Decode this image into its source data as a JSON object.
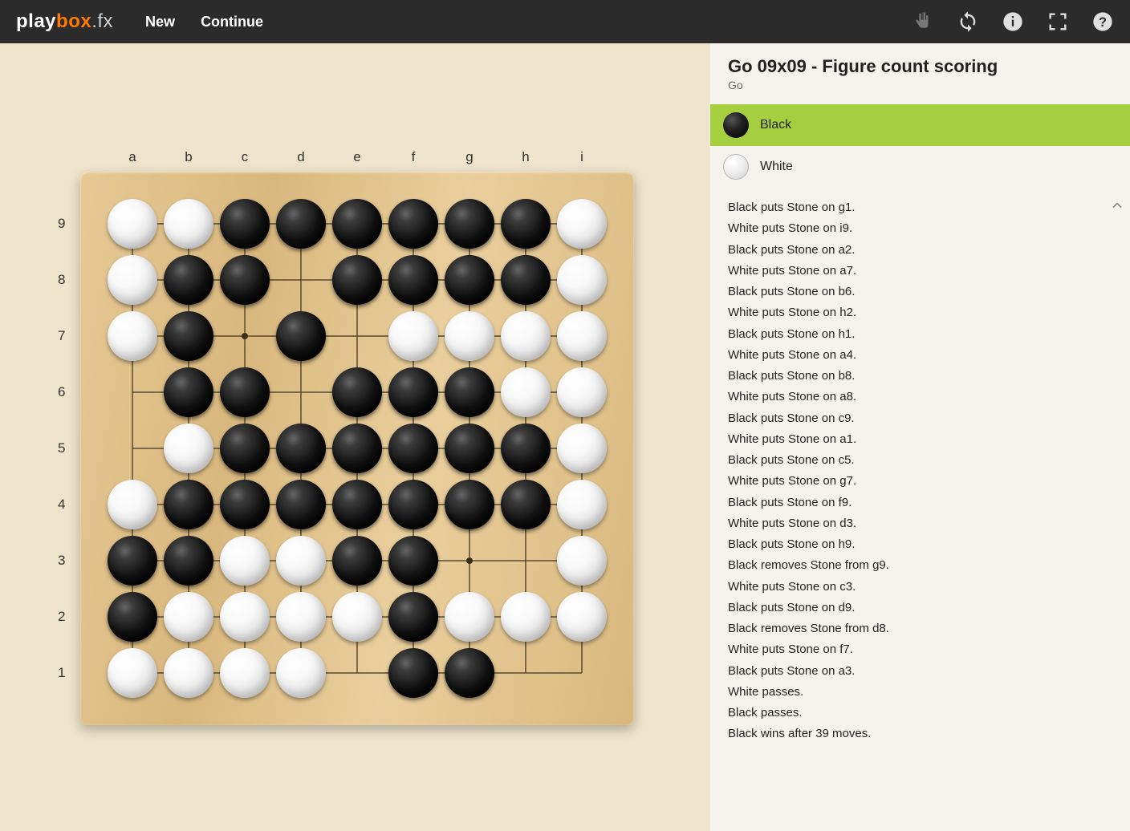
{
  "logo": {
    "part1": "play",
    "part2": "box",
    "part3": ".fx"
  },
  "nav": {
    "new": "New",
    "continue": "Continue"
  },
  "title": "Go 09x09 - Figure count scoring",
  "subtitle": "Go",
  "players": [
    {
      "name": "Black",
      "color": "B",
      "active": true
    },
    {
      "name": "White",
      "color": "W",
      "active": false
    }
  ],
  "board": {
    "size": 9,
    "cols": [
      "a",
      "b",
      "c",
      "d",
      "e",
      "f",
      "g",
      "h",
      "i"
    ],
    "rows": [
      "1",
      "2",
      "3",
      "4",
      "5",
      "6",
      "7",
      "8",
      "9"
    ],
    "stones": [
      {
        "c": "a",
        "r": 9,
        "s": "W"
      },
      {
        "c": "b",
        "r": 9,
        "s": "W"
      },
      {
        "c": "c",
        "r": 9,
        "s": "B"
      },
      {
        "c": "d",
        "r": 9,
        "s": "B"
      },
      {
        "c": "e",
        "r": 9,
        "s": "B"
      },
      {
        "c": "f",
        "r": 9,
        "s": "B"
      },
      {
        "c": "g",
        "r": 9,
        "s": "B"
      },
      {
        "c": "h",
        "r": 9,
        "s": "B"
      },
      {
        "c": "i",
        "r": 9,
        "s": "W"
      },
      {
        "c": "a",
        "r": 8,
        "s": "W"
      },
      {
        "c": "b",
        "r": 8,
        "s": "B"
      },
      {
        "c": "c",
        "r": 8,
        "s": "B"
      },
      {
        "c": "e",
        "r": 8,
        "s": "B"
      },
      {
        "c": "f",
        "r": 8,
        "s": "B"
      },
      {
        "c": "g",
        "r": 8,
        "s": "B"
      },
      {
        "c": "h",
        "r": 8,
        "s": "B"
      },
      {
        "c": "i",
        "r": 8,
        "s": "W"
      },
      {
        "c": "a",
        "r": 7,
        "s": "W"
      },
      {
        "c": "b",
        "r": 7,
        "s": "B"
      },
      {
        "c": "d",
        "r": 7,
        "s": "B"
      },
      {
        "c": "f",
        "r": 7,
        "s": "W"
      },
      {
        "c": "g",
        "r": 7,
        "s": "W"
      },
      {
        "c": "h",
        "r": 7,
        "s": "W"
      },
      {
        "c": "i",
        "r": 7,
        "s": "W"
      },
      {
        "c": "b",
        "r": 6,
        "s": "B"
      },
      {
        "c": "c",
        "r": 6,
        "s": "B"
      },
      {
        "c": "e",
        "r": 6,
        "s": "B"
      },
      {
        "c": "f",
        "r": 6,
        "s": "B"
      },
      {
        "c": "g",
        "r": 6,
        "s": "B"
      },
      {
        "c": "h",
        "r": 6,
        "s": "W"
      },
      {
        "c": "i",
        "r": 6,
        "s": "W"
      },
      {
        "c": "b",
        "r": 5,
        "s": "W"
      },
      {
        "c": "c",
        "r": 5,
        "s": "B"
      },
      {
        "c": "d",
        "r": 5,
        "s": "B"
      },
      {
        "c": "e",
        "r": 5,
        "s": "B"
      },
      {
        "c": "f",
        "r": 5,
        "s": "B"
      },
      {
        "c": "g",
        "r": 5,
        "s": "B"
      },
      {
        "c": "h",
        "r": 5,
        "s": "B"
      },
      {
        "c": "i",
        "r": 5,
        "s": "W"
      },
      {
        "c": "a",
        "r": 4,
        "s": "W"
      },
      {
        "c": "b",
        "r": 4,
        "s": "B"
      },
      {
        "c": "c",
        "r": 4,
        "s": "B"
      },
      {
        "c": "d",
        "r": 4,
        "s": "B"
      },
      {
        "c": "e",
        "r": 4,
        "s": "B"
      },
      {
        "c": "f",
        "r": 4,
        "s": "B"
      },
      {
        "c": "g",
        "r": 4,
        "s": "B"
      },
      {
        "c": "h",
        "r": 4,
        "s": "B"
      },
      {
        "c": "i",
        "r": 4,
        "s": "W"
      },
      {
        "c": "a",
        "r": 3,
        "s": "B"
      },
      {
        "c": "b",
        "r": 3,
        "s": "B"
      },
      {
        "c": "c",
        "r": 3,
        "s": "W"
      },
      {
        "c": "d",
        "r": 3,
        "s": "W"
      },
      {
        "c": "e",
        "r": 3,
        "s": "B"
      },
      {
        "c": "f",
        "r": 3,
        "s": "B"
      },
      {
        "c": "i",
        "r": 3,
        "s": "W"
      },
      {
        "c": "a",
        "r": 2,
        "s": "B"
      },
      {
        "c": "b",
        "r": 2,
        "s": "W"
      },
      {
        "c": "c",
        "r": 2,
        "s": "W"
      },
      {
        "c": "d",
        "r": 2,
        "s": "W"
      },
      {
        "c": "e",
        "r": 2,
        "s": "W"
      },
      {
        "c": "f",
        "r": 2,
        "s": "B"
      },
      {
        "c": "g",
        "r": 2,
        "s": "W"
      },
      {
        "c": "h",
        "r": 2,
        "s": "W"
      },
      {
        "c": "i",
        "r": 2,
        "s": "W"
      },
      {
        "c": "a",
        "r": 1,
        "s": "W"
      },
      {
        "c": "b",
        "r": 1,
        "s": "W"
      },
      {
        "c": "c",
        "r": 1,
        "s": "W"
      },
      {
        "c": "d",
        "r": 1,
        "s": "W"
      },
      {
        "c": "f",
        "r": 1,
        "s": "B"
      },
      {
        "c": "g",
        "r": 1,
        "s": "B"
      }
    ],
    "starPoints": [
      {
        "c": "c",
        "r": 7
      },
      {
        "c": "g",
        "r": 7
      },
      {
        "c": "e",
        "r": 5
      },
      {
        "c": "c",
        "r": 3
      },
      {
        "c": "g",
        "r": 3
      }
    ]
  },
  "log": [
    "Black puts Stone on g1.",
    "White puts Stone on i9.",
    "Black puts Stone on a2.",
    "White puts Stone on a7.",
    "Black puts Stone on b6.",
    "White puts Stone on h2.",
    "Black puts Stone on h1.",
    "White puts Stone on a4.",
    "Black puts Stone on b8.",
    "White puts Stone on a8.",
    "Black puts Stone on c9.",
    "White puts Stone on a1.",
    "Black puts Stone on c5.",
    "White puts Stone on g7.",
    "Black puts Stone on f9.",
    "White puts Stone on d3.",
    "Black puts Stone on h9.",
    "Black removes Stone from g9.",
    "White puts Stone on c3.",
    "Black puts Stone on d9.",
    "Black removes Stone from d8.",
    "White puts Stone on f7.",
    "Black puts Stone on a3.",
    "White passes.",
    "Black passes.",
    "Black wins after 39 moves."
  ]
}
